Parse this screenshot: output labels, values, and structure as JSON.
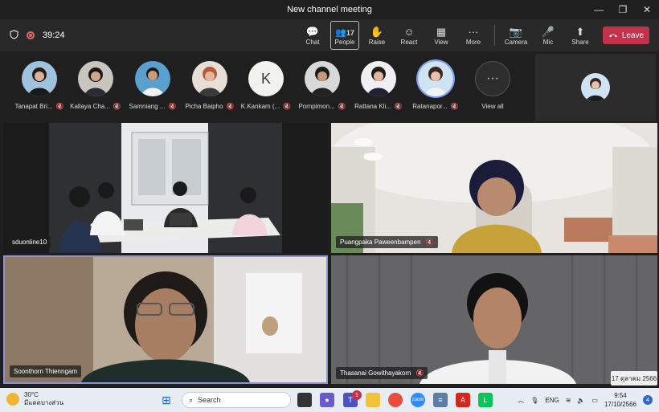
{
  "window": {
    "title": "New channel meeting",
    "controls": [
      "—",
      "❐",
      "✕"
    ]
  },
  "toolbar": {
    "timer": "39:24",
    "buttons": [
      {
        "label": "Chat",
        "icon": "💬"
      },
      {
        "label": "People",
        "icon": "👥",
        "count": "17"
      },
      {
        "label": "Raise",
        "icon": "✋"
      },
      {
        "label": "React",
        "icon": "☺"
      },
      {
        "label": "View",
        "icon": "▦"
      },
      {
        "label": "More",
        "icon": "···"
      },
      {
        "label": "Camera",
        "icon": "📷"
      },
      {
        "label": "Mic",
        "icon": "🎤"
      },
      {
        "label": "Share",
        "icon": "⬆"
      }
    ],
    "leave": "Leave"
  },
  "participants": [
    {
      "name": "Tanapat Bri..."
    },
    {
      "name": "Kallaya Cha..."
    },
    {
      "name": "Samniang ..."
    },
    {
      "name": "Picha Baipho"
    },
    {
      "name": "K.Kankam (...",
      "initial": "K"
    },
    {
      "name": "Pornpimon..."
    },
    {
      "name": "Rattana Kli..."
    },
    {
      "name": "Ratanapor..."
    },
    {
      "name": "View all",
      "icon": "···"
    }
  ],
  "tiles": [
    {
      "name": "sduonline10"
    },
    {
      "name": "Puangpaka Paweenbampen"
    },
    {
      "name": "Soonthorn Thienngam"
    },
    {
      "name": "Thasanai Gowithayakorn"
    }
  ],
  "date_popup": "17 ตุลาคม 2566",
  "taskbar": {
    "temp": "30°C",
    "weather": "มีแดดบางส่วน",
    "search": "Search",
    "teams_badge": "1",
    "lang": "ENG",
    "time": "9:54",
    "date": "17/10/2566",
    "notifications": "4"
  }
}
